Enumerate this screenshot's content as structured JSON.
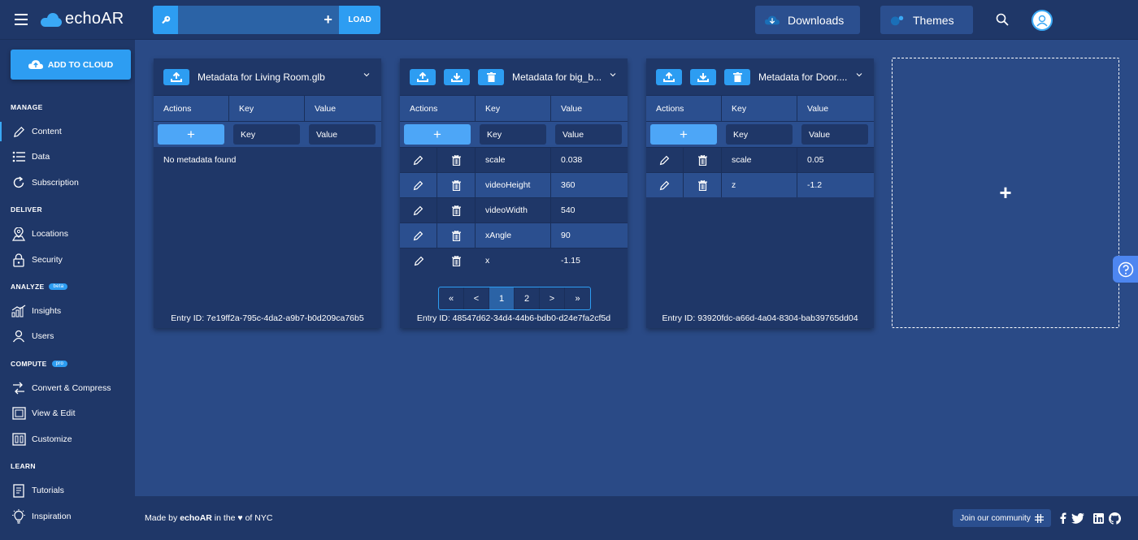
{
  "app": {
    "logo_text": "echoAR"
  },
  "topbar": {
    "key_value": "",
    "plus_label": "+",
    "load_label": "LOAD",
    "downloads_label": "Downloads",
    "themes_label": "Themes"
  },
  "sidebar": {
    "add_cloud_label": "ADD TO CLOUD",
    "sections": {
      "manage": "MANAGE",
      "deliver": "DELIVER",
      "analyze": "ANALYZE",
      "analyze_badge": "beta",
      "compute": "COMPUTE",
      "compute_badge": "pro",
      "learn": "LEARN"
    },
    "items": {
      "content": "Content",
      "data": "Data",
      "subscription": "Subscription",
      "locations": "Locations",
      "security": "Security",
      "insights": "Insights",
      "users": "Users",
      "convert": "Convert & Compress",
      "view_edit": "View & Edit",
      "customize": "Customize",
      "tutorials": "Tutorials",
      "inspiration": "Inspiration"
    }
  },
  "panels": [
    {
      "title": "Metadata for Living Room.glb",
      "headers": {
        "actions": "Actions",
        "key": "Key",
        "value": "Value"
      },
      "add_key_placeholder": "Key",
      "add_value_placeholder": "Value",
      "empty_message": "No metadata found",
      "rows": [],
      "entry_id": "Entry ID: 7e19ff2a-795c-4da2-a9b7-b0d209ca76b5"
    },
    {
      "title": "Metadata for big_b...",
      "headers": {
        "actions": "Actions",
        "key": "Key",
        "value": "Value"
      },
      "add_key_placeholder": "Key",
      "add_value_placeholder": "Value",
      "rows": [
        {
          "key": "scale",
          "value": "0.038"
        },
        {
          "key": "videoHeight",
          "value": "360"
        },
        {
          "key": "videoWidth",
          "value": "540"
        },
        {
          "key": "xAngle",
          "value": "90"
        },
        {
          "key": "x",
          "value": "-1.15"
        }
      ],
      "pager": [
        "«",
        "<",
        "1",
        "2",
        ">",
        "»"
      ],
      "entry_id": "Entry ID: 48547d62-34d4-44b6-bdb0-d24e7fa2cf5d"
    },
    {
      "title": "Metadata for Door....",
      "headers": {
        "actions": "Actions",
        "key": "Key",
        "value": "Value"
      },
      "add_key_placeholder": "Key",
      "add_value_placeholder": "Value",
      "rows": [
        {
          "key": "scale",
          "value": "0.05"
        },
        {
          "key": "z",
          "value": "-1.2"
        }
      ],
      "entry_id": "Entry ID: 93920fdc-a66d-4a04-8304-bab39765dd04"
    }
  ],
  "add_panel_label": "+",
  "footer": {
    "made_prefix": "Made by ",
    "made_brand": "echoAR",
    "made_suffix": " in the ♥ of NYC",
    "community_label": "Join our community"
  },
  "colors": {
    "accent": "#2d9df2",
    "background": "#2a4a86",
    "panel": "#1f3768"
  }
}
